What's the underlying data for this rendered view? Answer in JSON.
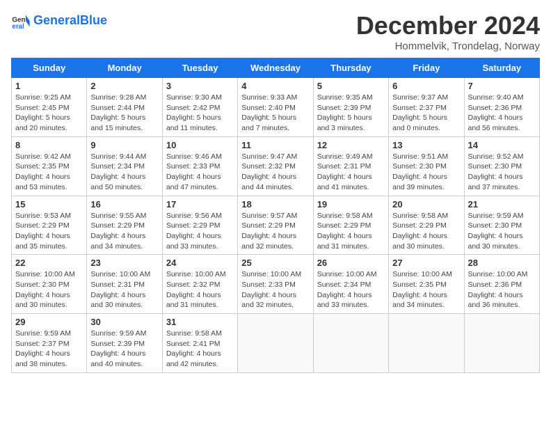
{
  "logo": {
    "text_general": "General",
    "text_blue": "Blue"
  },
  "header": {
    "title": "December 2024",
    "subtitle": "Hommelvik, Trondelag, Norway"
  },
  "weekdays": [
    "Sunday",
    "Monday",
    "Tuesday",
    "Wednesday",
    "Thursday",
    "Friday",
    "Saturday"
  ],
  "weeks": [
    [
      {
        "day": "1",
        "sunrise": "9:25 AM",
        "sunset": "2:45 PM",
        "daylight": "5 hours and 20 minutes."
      },
      {
        "day": "2",
        "sunrise": "9:28 AM",
        "sunset": "2:44 PM",
        "daylight": "5 hours and 15 minutes."
      },
      {
        "day": "3",
        "sunrise": "9:30 AM",
        "sunset": "2:42 PM",
        "daylight": "5 hours and 11 minutes."
      },
      {
        "day": "4",
        "sunrise": "9:33 AM",
        "sunset": "2:40 PM",
        "daylight": "5 hours and 7 minutes."
      },
      {
        "day": "5",
        "sunrise": "9:35 AM",
        "sunset": "2:39 PM",
        "daylight": "5 hours and 3 minutes."
      },
      {
        "day": "6",
        "sunrise": "9:37 AM",
        "sunset": "2:37 PM",
        "daylight": "5 hours and 0 minutes."
      },
      {
        "day": "7",
        "sunrise": "9:40 AM",
        "sunset": "2:36 PM",
        "daylight": "4 hours and 56 minutes."
      }
    ],
    [
      {
        "day": "8",
        "sunrise": "9:42 AM",
        "sunset": "2:35 PM",
        "daylight": "4 hours and 53 minutes."
      },
      {
        "day": "9",
        "sunrise": "9:44 AM",
        "sunset": "2:34 PM",
        "daylight": "4 hours and 50 minutes."
      },
      {
        "day": "10",
        "sunrise": "9:46 AM",
        "sunset": "2:33 PM",
        "daylight": "4 hours and 47 minutes."
      },
      {
        "day": "11",
        "sunrise": "9:47 AM",
        "sunset": "2:32 PM",
        "daylight": "4 hours and 44 minutes."
      },
      {
        "day": "12",
        "sunrise": "9:49 AM",
        "sunset": "2:31 PM",
        "daylight": "4 hours and 41 minutes."
      },
      {
        "day": "13",
        "sunrise": "9:51 AM",
        "sunset": "2:30 PM",
        "daylight": "4 hours and 39 minutes."
      },
      {
        "day": "14",
        "sunrise": "9:52 AM",
        "sunset": "2:30 PM",
        "daylight": "4 hours and 37 minutes."
      }
    ],
    [
      {
        "day": "15",
        "sunrise": "9:53 AM",
        "sunset": "2:29 PM",
        "daylight": "4 hours and 35 minutes."
      },
      {
        "day": "16",
        "sunrise": "9:55 AM",
        "sunset": "2:29 PM",
        "daylight": "4 hours and 34 minutes."
      },
      {
        "day": "17",
        "sunrise": "9:56 AM",
        "sunset": "2:29 PM",
        "daylight": "4 hours and 33 minutes."
      },
      {
        "day": "18",
        "sunrise": "9:57 AM",
        "sunset": "2:29 PM",
        "daylight": "4 hours and 32 minutes."
      },
      {
        "day": "19",
        "sunrise": "9:58 AM",
        "sunset": "2:29 PM",
        "daylight": "4 hours and 31 minutes."
      },
      {
        "day": "20",
        "sunrise": "9:58 AM",
        "sunset": "2:29 PM",
        "daylight": "4 hours and 30 minutes."
      },
      {
        "day": "21",
        "sunrise": "9:59 AM",
        "sunset": "2:30 PM",
        "daylight": "4 hours and 30 minutes."
      }
    ],
    [
      {
        "day": "22",
        "sunrise": "10:00 AM",
        "sunset": "2:30 PM",
        "daylight": "4 hours and 30 minutes."
      },
      {
        "day": "23",
        "sunrise": "10:00 AM",
        "sunset": "2:31 PM",
        "daylight": "4 hours and 30 minutes."
      },
      {
        "day": "24",
        "sunrise": "10:00 AM",
        "sunset": "2:32 PM",
        "daylight": "4 hours and 31 minutes."
      },
      {
        "day": "25",
        "sunrise": "10:00 AM",
        "sunset": "2:33 PM",
        "daylight": "4 hours and 32 minutes."
      },
      {
        "day": "26",
        "sunrise": "10:00 AM",
        "sunset": "2:34 PM",
        "daylight": "4 hours and 33 minutes."
      },
      {
        "day": "27",
        "sunrise": "10:00 AM",
        "sunset": "2:35 PM",
        "daylight": "4 hours and 34 minutes."
      },
      {
        "day": "28",
        "sunrise": "10:00 AM",
        "sunset": "2:36 PM",
        "daylight": "4 hours and 36 minutes."
      }
    ],
    [
      {
        "day": "29",
        "sunrise": "9:59 AM",
        "sunset": "2:37 PM",
        "daylight": "4 hours and 38 minutes."
      },
      {
        "day": "30",
        "sunrise": "9:59 AM",
        "sunset": "2:39 PM",
        "daylight": "4 hours and 40 minutes."
      },
      {
        "day": "31",
        "sunrise": "9:58 AM",
        "sunset": "2:41 PM",
        "daylight": "4 hours and 42 minutes."
      },
      null,
      null,
      null,
      null
    ]
  ]
}
